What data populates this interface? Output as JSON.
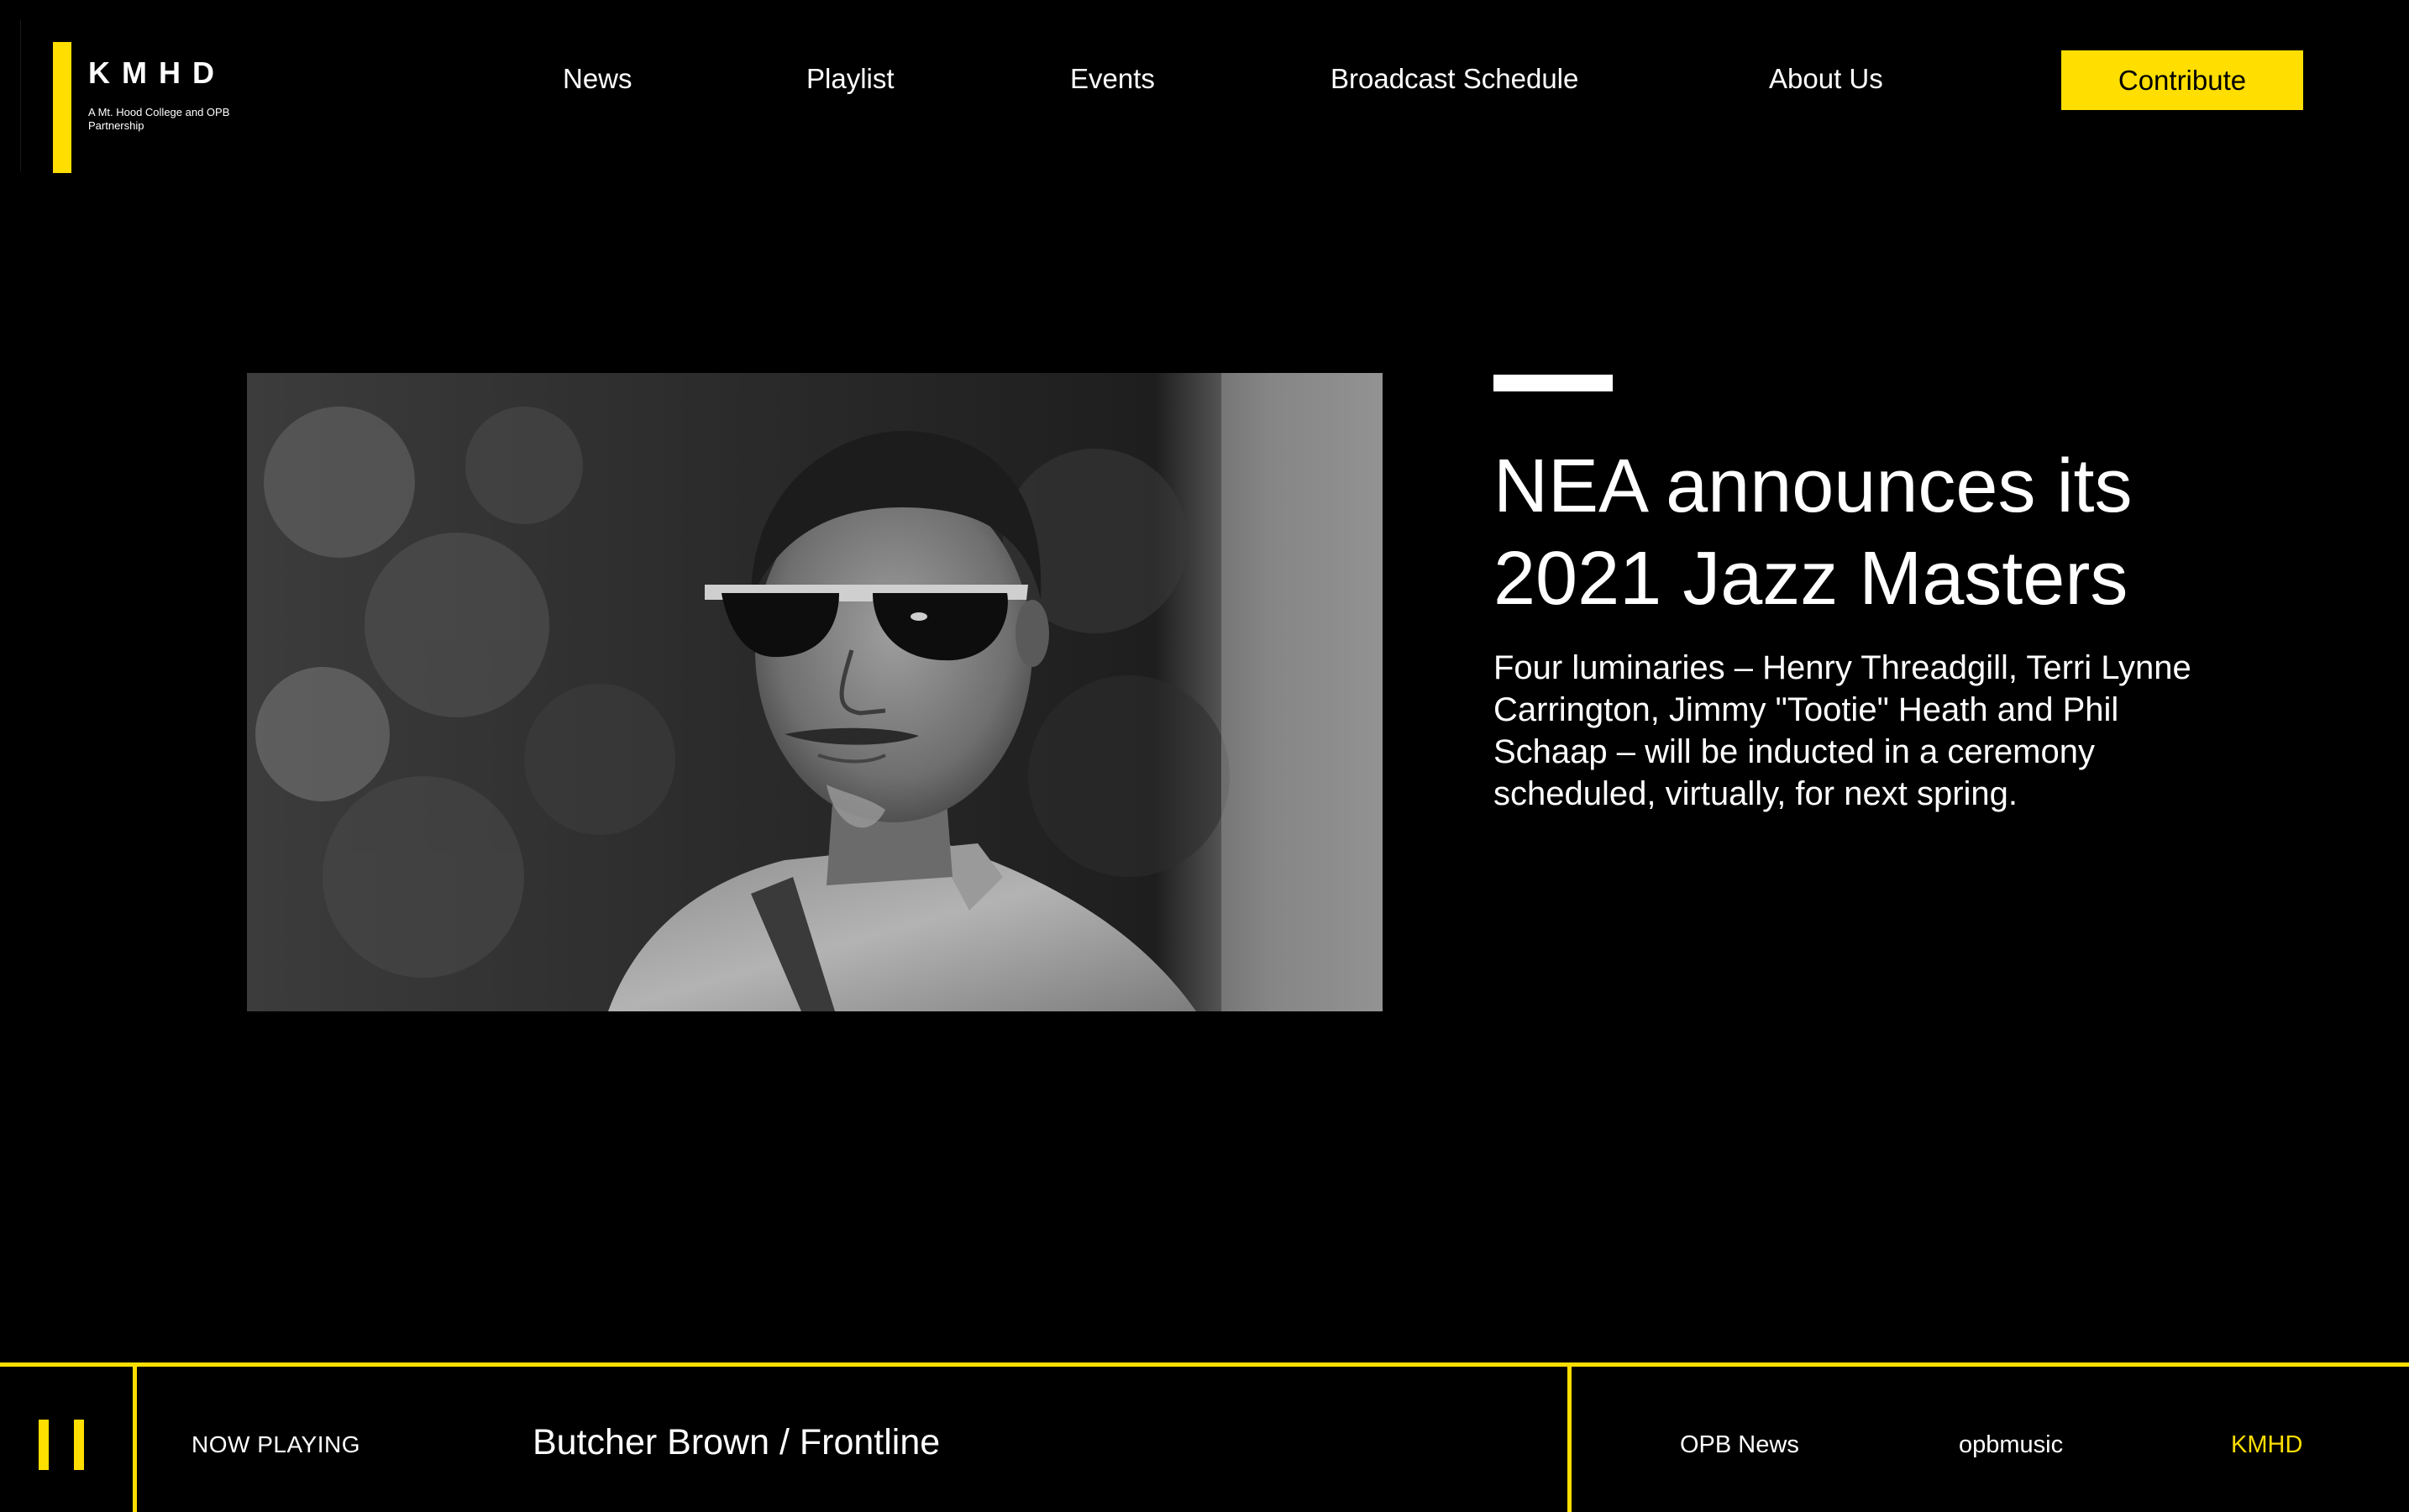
{
  "colors": {
    "accent": "#ffde00",
    "background": "#000000",
    "text": "#ffffff"
  },
  "brand": {
    "name": "KMHD",
    "tagline": "A Mt. Hood College and OPB Partnership"
  },
  "nav": {
    "items": [
      {
        "label": "News"
      },
      {
        "label": "Playlist"
      },
      {
        "label": "Events"
      },
      {
        "label": "Broadcast Schedule"
      },
      {
        "label": "About Us"
      }
    ],
    "cta_label": "Contribute"
  },
  "feature": {
    "headline": "NEA announces its 2021 Jazz Masters",
    "summary": "Four luminaries – Henry Threadgill, Terri Lynne Carrington, Jimmy \"Tootie\" Heath and Phil Schaap – will be inducted in a ceremony scheduled, virtually, for next spring.",
    "image_description": "black-and-white portrait photo"
  },
  "player": {
    "status_label": "NOW PLAYING",
    "track": "Butcher Brown / Frontline",
    "pause_icon": "pause-icon",
    "stations": [
      {
        "label": "OPB News",
        "active": false
      },
      {
        "label": "opbmusic",
        "active": false
      },
      {
        "label": "KMHD",
        "active": true
      }
    ]
  }
}
